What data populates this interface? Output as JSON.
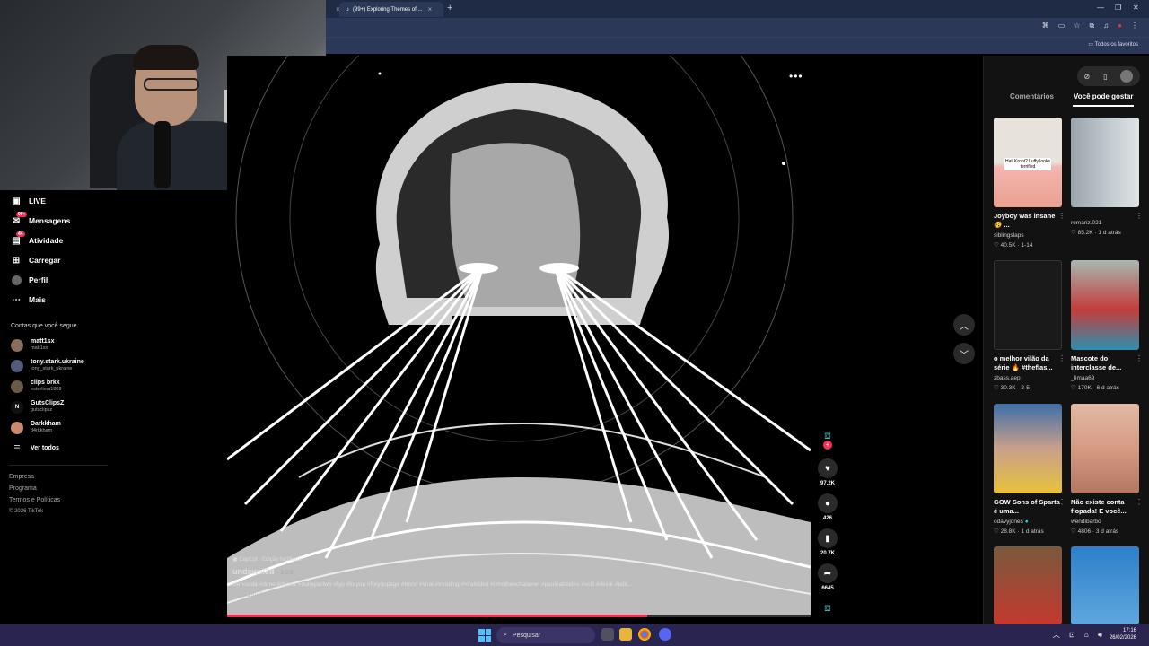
{
  "browser": {
    "tabs": [
      {
        "label": "",
        "active": false
      },
      {
        "label": "(99+) Exploring Themes of ...",
        "active": true
      }
    ],
    "bookmarks_label": "Todos os favoritos"
  },
  "sidebar": {
    "items": [
      {
        "label": "LIVE",
        "icon": "live-icon"
      },
      {
        "label": "Mensagens",
        "icon": "messages-icon",
        "badge": "99+"
      },
      {
        "label": "Atividade",
        "icon": "activity-icon",
        "badge": "44"
      },
      {
        "label": "Carregar",
        "icon": "upload-icon"
      },
      {
        "label": "Perfil",
        "icon": "profile-icon"
      },
      {
        "label": "Mais",
        "icon": "more-icon"
      }
    ],
    "following_title": "Contas que você segue",
    "following": [
      {
        "name": "matt1sx",
        "handle": "matt1sx"
      },
      {
        "name": "tony.stark.ukraine",
        "handle": "tony_stark_ukraine"
      },
      {
        "name": "clips brkk",
        "handle": "esterlima1809"
      },
      {
        "name": "GutsClipsZ",
        "handle": "gutsclipsz"
      },
      {
        "name": "Darkkham",
        "handle": "d4rkkham"
      }
    ],
    "see_all": "Ver todos",
    "footer": [
      "Empresa",
      "Programa",
      "Termos e Políticas",
      "© 2026 TikTok"
    ]
  },
  "video": {
    "capcut": "CapCut · Edição facilitada",
    "author": "undewal3d",
    "date": "· 1-23",
    "hashtags": "Genocide #dune #dune2 #dunepartwo #fyp #foryou #foryoupage #trend #viral #trending #viralvideo #timotheechalamet #pauleatreides #scifi #4kink #edit...",
    "translate": "Ver tradução",
    "progress": 0.72
  },
  "actions": {
    "likes": "97.2K",
    "comments": "426",
    "saves": "20.7K",
    "shares": "6645"
  },
  "right_panel": {
    "tabs": [
      "Comentários",
      "Você pode gostar"
    ],
    "active_tab": 1,
    "cards": [
      {
        "title": "Joyboy was insane 🫨 ...",
        "author": "siblingslaps",
        "likes": "40.5K",
        "date": "1-14",
        "thumb_text": "Hail Kroot? Luffy looks terrified"
      },
      {
        "title": "",
        "author": "romariz.021",
        "likes": "85.2K",
        "date": "1 d atrás",
        "thumb_text": ""
      },
      {
        "title": "o melhor vilão da série 🔥 #theflas...",
        "author": "zbass.aep",
        "likes": "30.3K",
        "date": "2-5",
        "thumb_text": ""
      },
      {
        "title": "Mascote do interclasse de...",
        "author": "_limaa69",
        "likes": "170K",
        "date": "6 d atrás",
        "thumb_text": ""
      },
      {
        "title": "GOW Sons of Sparta é uma...",
        "author": "odavyjones",
        "likes": "28.8K",
        "date": "1 d atrás",
        "thumb_text": ""
      },
      {
        "title": "Não existe conta flopada! E você...",
        "author": "wendibarbo",
        "likes": "4806",
        "date": "3 d atrás",
        "thumb_text": ""
      }
    ]
  },
  "taskbar": {
    "search_label": "Pesquisar",
    "time": "17:16",
    "date": "26/02/2026"
  }
}
